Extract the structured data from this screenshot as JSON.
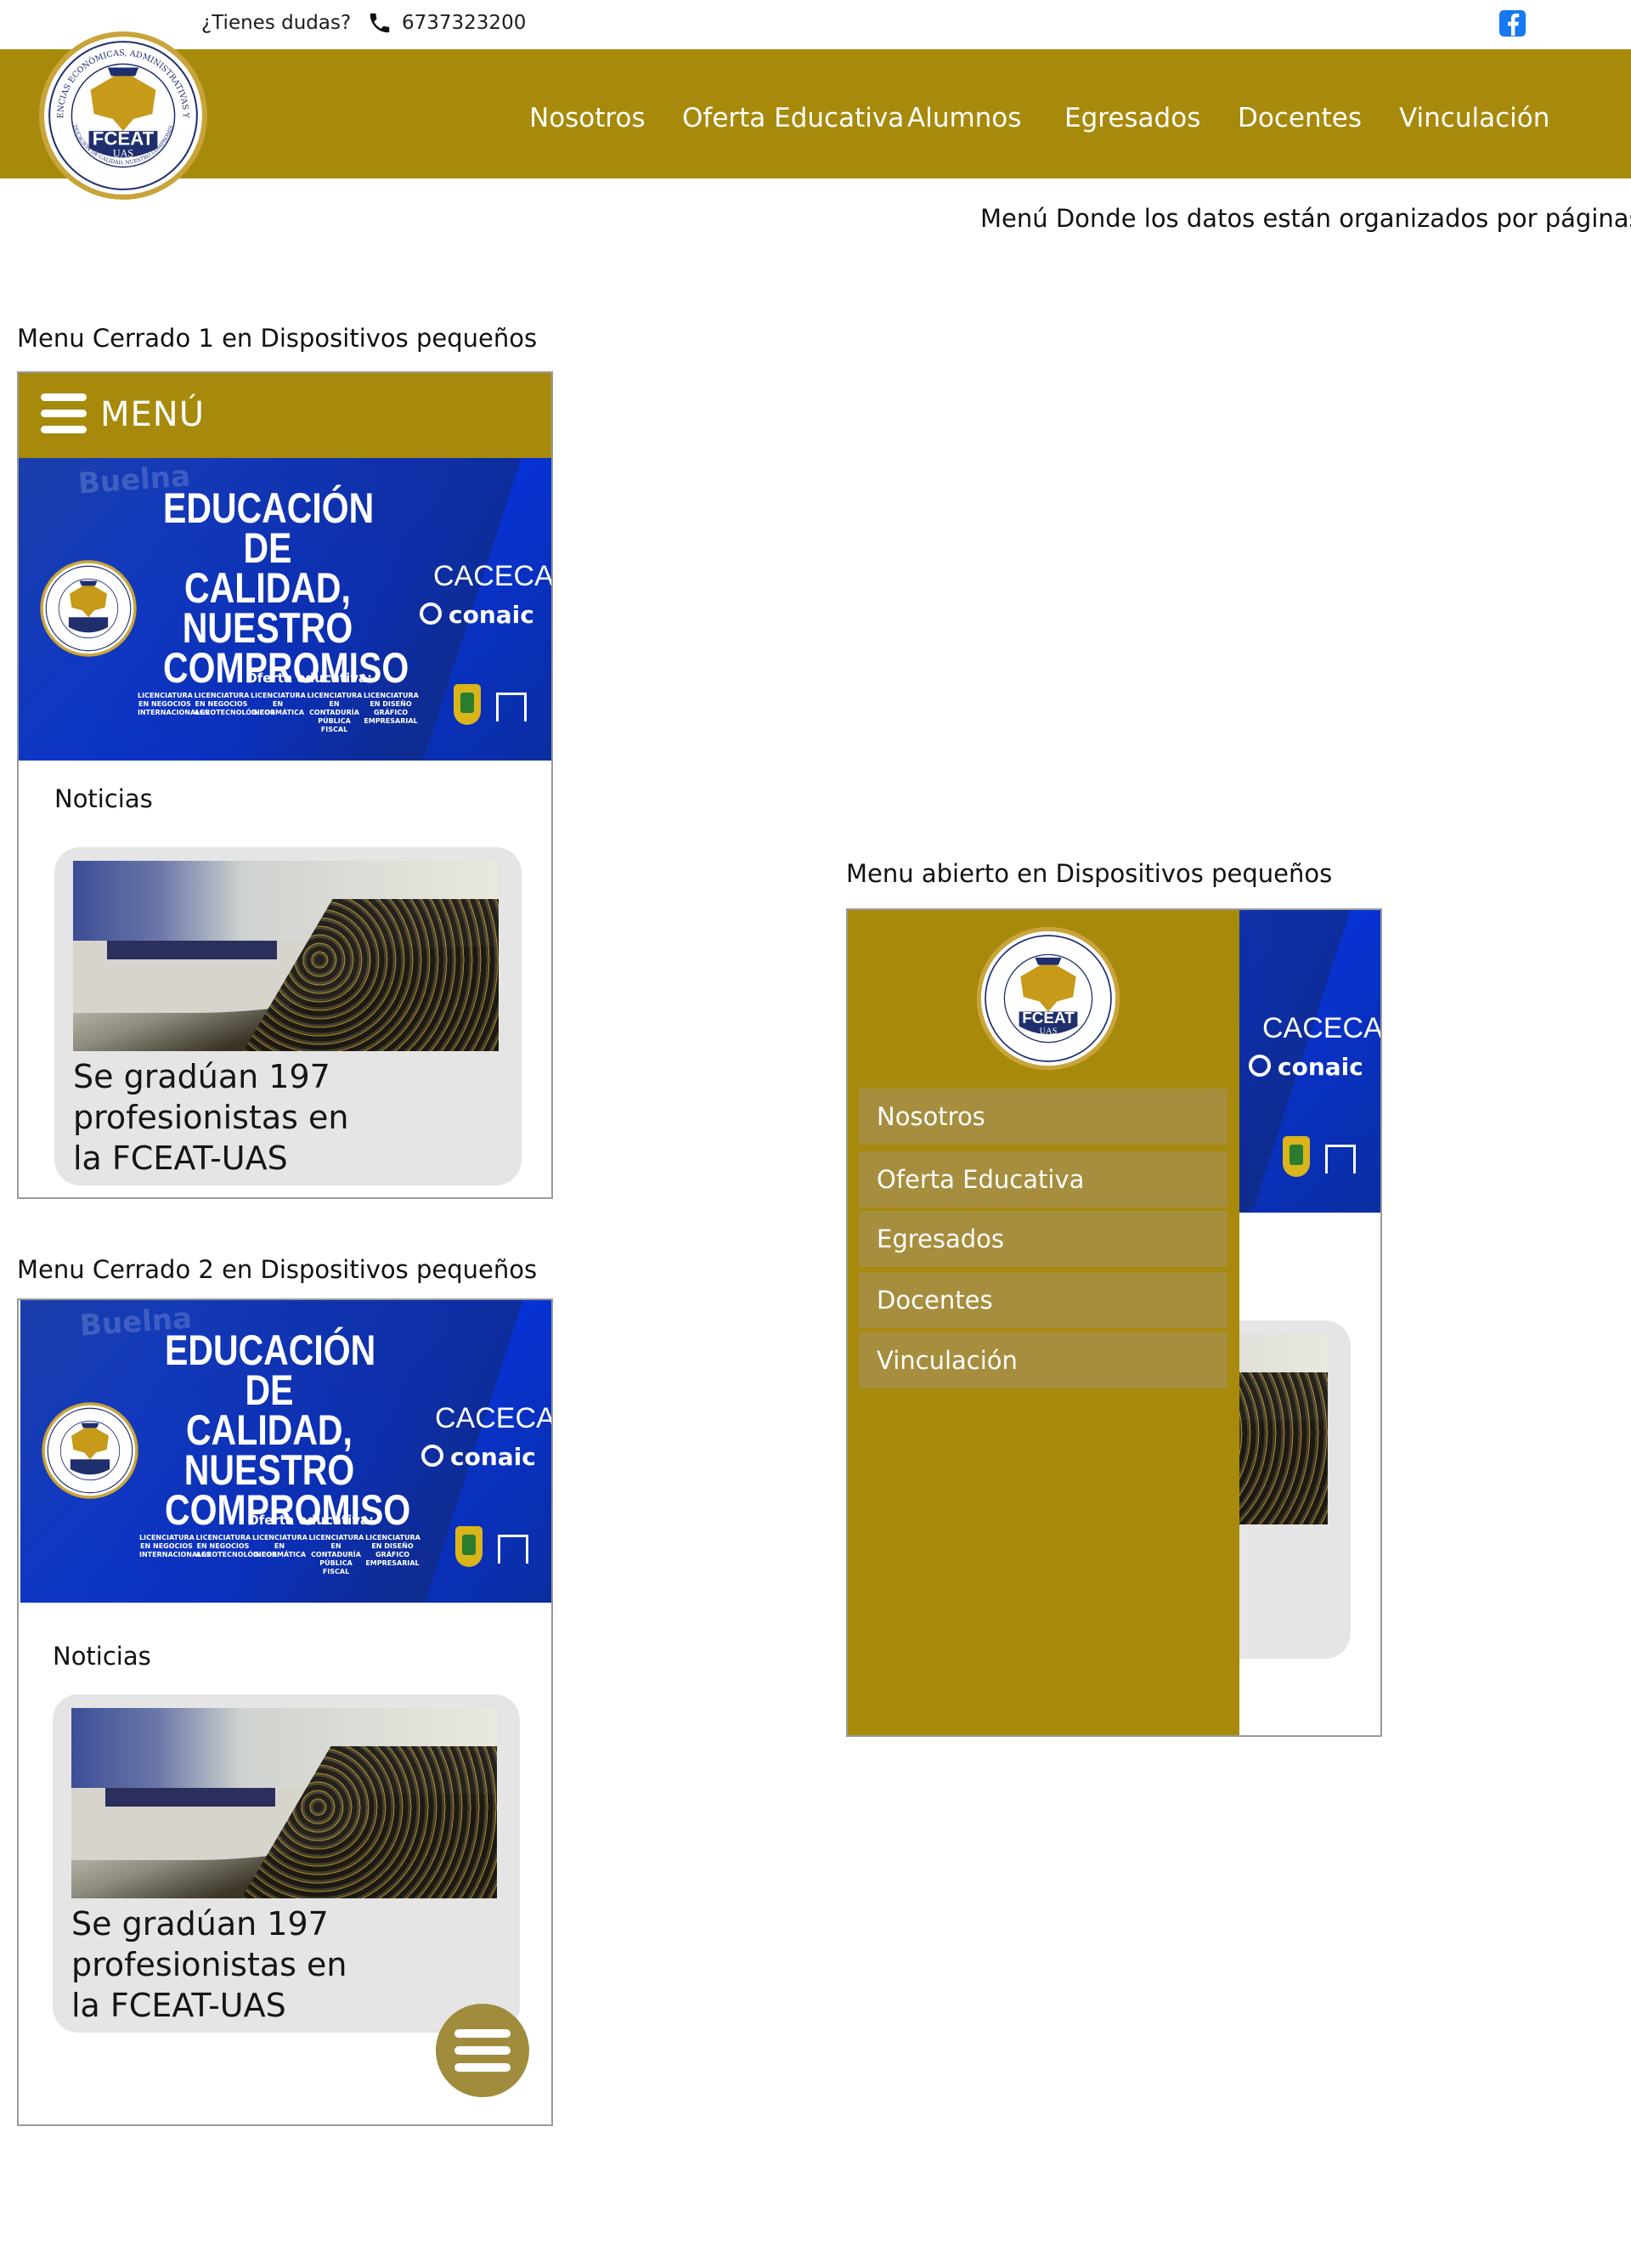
{
  "topbar": {
    "question": "¿Tienes dudas?",
    "phone": "6737323200",
    "phone_icon": "phone-icon",
    "social_icon": "facebook-icon"
  },
  "header": {
    "logo": {
      "ring_text": "FACULTAD DE CIENCIAS ECONÓMICAS, ADMINISTRATIVAS Y TECNOLÓGICAS",
      "motto": "EDUCACIÓN DE CALIDAD, NUESTRO COMPROMISO",
      "name": "FCEAT",
      "sub": "UAS"
    },
    "nav": [
      "Nosotros",
      "Oferta Educativa",
      "Alumnos",
      "Egresados",
      "Docentes",
      "Vinculación"
    ],
    "bg_color": "#a78a0c"
  },
  "desc_main": "Menú Donde los datos están organizados por páginas",
  "labels": {
    "closed1": "Menu Cerrado 1 en Dispositivos pequeños",
    "closed2": "Menu Cerrado 2 en Dispositivos pequeños",
    "open": "Menu abierto en Dispositivos pequeños"
  },
  "mobile": {
    "menu_label": "MENÚ",
    "banner": {
      "watermark": "Buelna",
      "headline": "EDUCACIÓN DE CALIDAD, NUESTRO COMPROMISO",
      "offer": "Oferta educativa:",
      "programs": [
        "LICENCIATURA EN NEGOCIOS INTERNACIONALES",
        "LICENCIATURA EN NEGOCIOS AGROTECNOLÓGICOS",
        "LICENCIATURA EN INFORMÁTICA",
        "LICENCIATURA EN CONTADURÍA PÚBLICA FISCAL",
        "LICENCIATURA EN DISEÑO GRÁFICO EMPRESARIAL"
      ],
      "accreditor1": "CACECA",
      "accreditor2": "conaic"
    },
    "news_title": "Noticias",
    "news_headline": "Se gradúan 197 profesionistas en la FCEAT-UAS",
    "drawer_items": [
      "Nosotros",
      "Oferta Educativa",
      "Egresados",
      "Docentes",
      "Vinculación"
    ],
    "fab_color": "#a08c3c"
  }
}
